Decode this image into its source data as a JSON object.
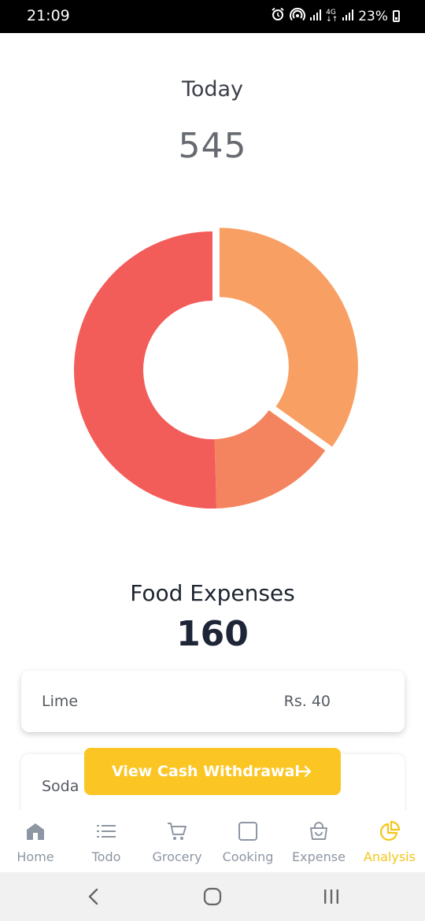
{
  "status_bar": {
    "time": "21:09",
    "network_label_top": "4G",
    "network_label_bottom": "↓↑",
    "battery": "23%",
    "icons": [
      "alarm-icon",
      "hotspot-icon",
      "signal-icon",
      "signal-icon",
      "battery-icon"
    ]
  },
  "summary": {
    "label": "Today",
    "value": "545"
  },
  "chart_data": {
    "type": "pie",
    "values": [
      190,
      80,
      275
    ],
    "colors": [
      "#f89f64",
      "#f4845f",
      "#f25c59"
    ],
    "hole_ratio": 0.5,
    "exploded_slice": 0
  },
  "category": {
    "label": "Food Expenses",
    "value": "160"
  },
  "items": [
    {
      "name": "Lime",
      "amount": "Rs. 40"
    },
    {
      "name": "Soda",
      "amount": ""
    }
  ],
  "cta": {
    "label": "View Cash Withdrawal",
    "icon": "arrow-right-icon",
    "color": "#fbc624"
  },
  "nav": {
    "active_color": "#f4c518",
    "inactive_color": "#8e96a3",
    "items": [
      {
        "label": "Home",
        "icon": "home-icon"
      },
      {
        "label": "Todo",
        "icon": "list-icon"
      },
      {
        "label": "Grocery",
        "icon": "cart-icon"
      },
      {
        "label": "Cooking",
        "icon": "square-icon"
      },
      {
        "label": "Expense",
        "icon": "bag-icon"
      },
      {
        "label": "Analysis",
        "icon": "pie-chart-icon"
      }
    ],
    "active_index": 5
  },
  "system_nav": [
    "back-icon",
    "home-circle-icon",
    "recents-icon"
  ]
}
